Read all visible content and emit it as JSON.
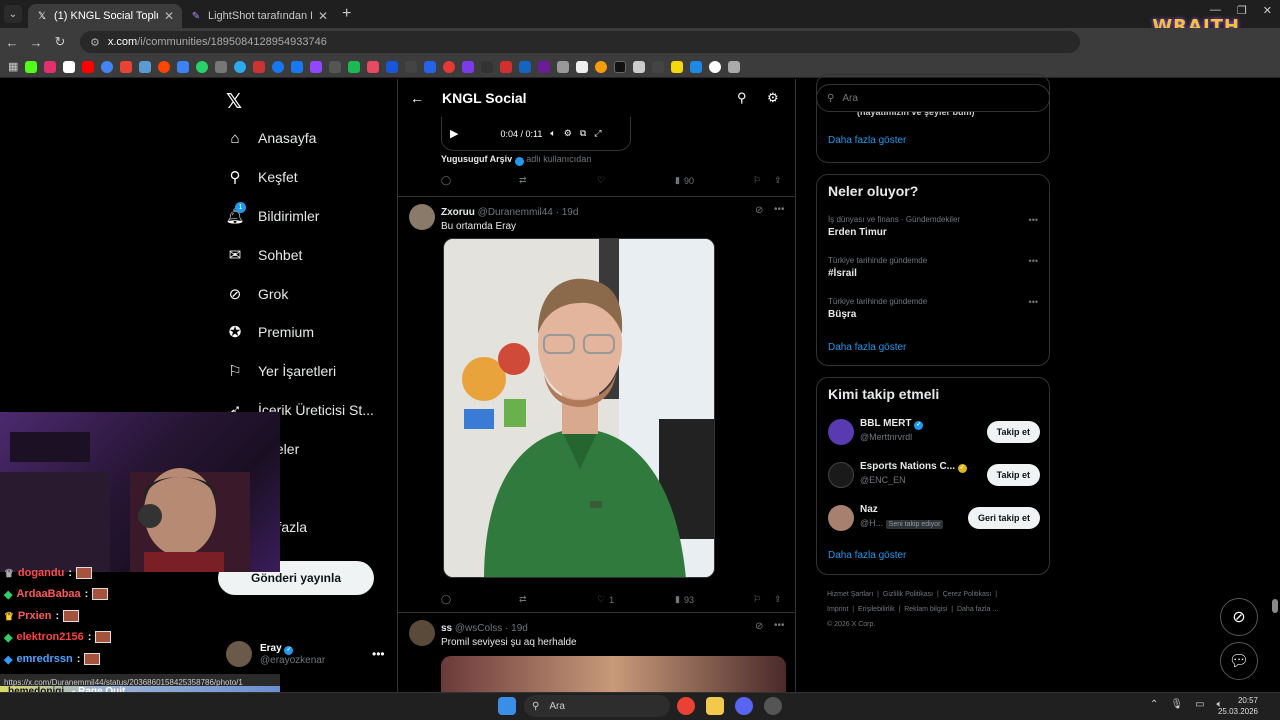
{
  "browser": {
    "tabs": [
      {
        "label": "(1) KNGL Social Topluluk / X",
        "active": true
      },
      {
        "label": "LightShot tarafından Ekran Gör",
        "active": false
      }
    ],
    "url_host": "x.com",
    "url_path": "/i/communities/1895084128954933746",
    "overlay_logo": "WRAITH"
  },
  "nav": {
    "items": [
      {
        "label": "Anasayfa",
        "icon": "home-icon"
      },
      {
        "label": "Keşfet",
        "icon": "search-icon"
      },
      {
        "label": "Bildirimler",
        "icon": "bell-icon",
        "badge": "1"
      },
      {
        "label": "Sohbet",
        "icon": "mail-icon"
      },
      {
        "label": "Grok",
        "icon": "grok-icon"
      },
      {
        "label": "Premium",
        "icon": "verified-icon"
      },
      {
        "label": "Yer İşaretleri",
        "icon": "bookmark-icon"
      },
      {
        "label": "İçerik Üreticisi St...",
        "icon": "rocket-icon"
      },
      {
        "label": "kaleler",
        "icon": "article-icon"
      },
      {
        "label": "ofil",
        "icon": "profile-icon"
      },
      {
        "label": "ha fazla",
        "icon": "more-icon"
      }
    ],
    "post_button": "Gönderi yayınla",
    "account": {
      "name": "Eray",
      "handle": "@erayozkenar"
    }
  },
  "feed": {
    "title": "KNGL Social",
    "player": {
      "time": "0:04 / 0:11"
    },
    "source": {
      "name": "Yugusuguf Arşiv",
      "note": "adlı kullanıcıdan"
    },
    "top_actions": {
      "views": "90"
    },
    "tweet1": {
      "name": "Zxoruu",
      "handle": "@Duranemmil44",
      "time": "· 19d",
      "text": "Bu ortamda  Eray",
      "likes": "1",
      "views": "93"
    },
    "tweet2": {
      "name": "ss",
      "handle": "@wsColss",
      "time": "· 19d",
      "text": "Promil seviyesi şu aq herhalde"
    }
  },
  "right": {
    "search_placeholder": "Ara",
    "prev_card_text": "(hayatımızın ve şeyler bum)",
    "show_more": "Daha fazla göster",
    "trending": {
      "title": "Neler oluyor?",
      "items": [
        {
          "category": "İş dünyası ve finans · Gündemdekiler",
          "name": "Erden Timur"
        },
        {
          "category": "Türkiye tarihinde gündemde",
          "name": "#İsrail"
        },
        {
          "category": "Türkiye tarihinde gündemde",
          "name": "Büşra"
        }
      ]
    },
    "who": {
      "title": "Kimi takip etmeli",
      "items": [
        {
          "name": "BBL MERT",
          "handle": "@Merttnrvrdl",
          "button": "Takip et",
          "badge": ""
        },
        {
          "name": "Esports Nations C...",
          "handle": "@ENC_EN",
          "button": "Takip et",
          "badge": ""
        },
        {
          "name": "Naz",
          "handle": "@H...",
          "button": "Geri takip et",
          "badge": "Seni takip ediyor"
        }
      ]
    },
    "footer": [
      "Hizmet Şartları",
      "Gizlilik Politikası",
      "Çerez Politikası",
      "Imprint",
      "Erişilebilirlik",
      "Reklam bilgisi",
      "Daha fazla ...",
      "© 2026 X Corp."
    ]
  },
  "stream": {
    "chat": [
      {
        "user": "dogandu",
        "color": "#ff4d4d"
      },
      {
        "user": "ArdaaBabaa",
        "color": "#ff5a5a"
      },
      {
        "user": "Prxien",
        "color": "#ff5a5a"
      },
      {
        "user": "elektron2156",
        "color": "#ff4040"
      },
      {
        "user": "emredrssn",
        "color": "#4da3ff"
      }
    ],
    "status_url": "https://x.com/Duranemmil44/status/2036860158425358786/photo/1",
    "alert_user": "hemedonigi",
    "alert_text": "- Rage Quit"
  },
  "taskbar": {
    "search": "Ara",
    "time": "20:57",
    "date": "25.03.2026"
  },
  "colors": {
    "accent": "#1d9bf0",
    "bg": "#000000",
    "border": "#2f3336"
  }
}
